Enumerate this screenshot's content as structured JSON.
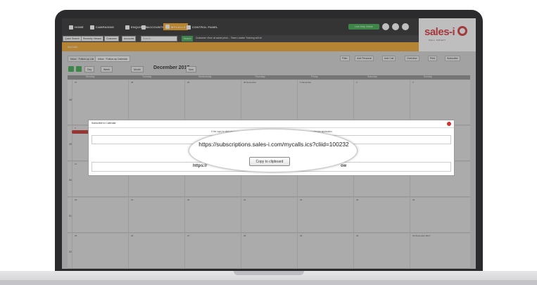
{
  "nav": {
    "items": [
      {
        "label": "HOME",
        "icon": "home-icon"
      },
      {
        "label": "CAMPAIGNS",
        "icon": "campaigns-icon"
      },
      {
        "label": "ENQUIRIES",
        "icon": "enquiries-icon"
      },
      {
        "label": "ACCOUNTS",
        "icon": "accounts-icon"
      },
      {
        "label": "MYCALLS",
        "icon": "mycalls-icon"
      },
      {
        "label": "CONTROL PANEL",
        "icon": "control-panel-icon"
      }
    ],
    "live_help": "Live Help Online",
    "accent": "#f4a620"
  },
  "logo": {
    "text": "sales-i",
    "sub": "SELL SMART"
  },
  "searchbar": {
    "quick_search": "Quick Search",
    "recently_viewed": "Recently Viewed",
    "customer": "Customer",
    "accounts": "Accounts",
    "search_placeholder": "Search...",
    "search_button": "Search",
    "customer_view": "Customer View",
    "ticker": "at same price... Team Leader Training will ch"
  },
  "titlebar": {
    "label": "MyCalls"
  },
  "tabs": [
    {
      "label": "Inbox · Follow-up List"
    },
    {
      "label": "Inbox · Follow-up Calendar"
    }
  ],
  "actions": [
    "Filter",
    "Add Personal",
    "Add Call",
    "Overview",
    "Print",
    "Subscribe"
  ],
  "calendar_nav": {
    "day": "Day",
    "week": "Week",
    "month": "Month",
    "title": "December 2017",
    "now": "Now"
  },
  "calendar": {
    "days": [
      "Monday",
      "Tuesday",
      "Wednesday",
      "Thursday",
      "Friday",
      "Saturday",
      "Sunday"
    ],
    "weeks": [
      {
        "num": "48",
        "dates": [
          "27",
          "28",
          "29",
          "30 November",
          "1 December",
          "2",
          "3"
        ]
      },
      {
        "num": "49",
        "dates": [
          "4",
          "5",
          "6",
          "7",
          "8",
          "9",
          "10"
        ]
      },
      {
        "num": "50",
        "dates": [
          "11",
          "12",
          "13",
          "14",
          "15",
          "16",
          "17"
        ]
      },
      {
        "num": "51",
        "dates": [
          "18",
          "19",
          "20",
          "21",
          "22",
          "23",
          "24"
        ]
      },
      {
        "num": "52",
        "dates": [
          "25",
          "26",
          "27",
          "28",
          "29",
          "30",
          "31 December 2017"
        ]
      }
    ]
  },
  "modal": {
    "title": "Subscribe to Calendar",
    "instruction": "If the copy to clipboard button does not work please copy and paste the link below into your preferred calendar application.",
    "ghost_left": "https://",
    "ghost_right": "ow"
  },
  "lens": {
    "url": "https://subscriptions.sales-i.com/mycalls.ics?cliid=100232",
    "copy_button": "Copy to clipboard"
  }
}
